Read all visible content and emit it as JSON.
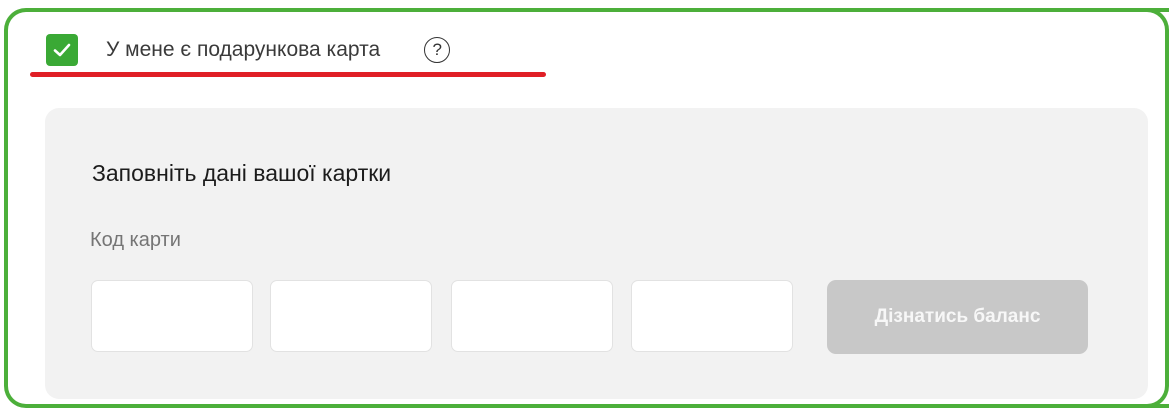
{
  "gift_card": {
    "checkbox_checked": true,
    "checkbox_label": "У мене є подарункова карта",
    "help_icon": "question-circle-icon",
    "check_icon": "checkmark-icon",
    "panel_title": "Заповніть дані вашої картки",
    "code_label": "Код карти",
    "code_fields": [
      "",
      "",
      "",
      ""
    ],
    "balance_button_label": "Дізнатись баланс",
    "balance_button_enabled": false
  },
  "colors": {
    "frame_border": "#4caf3a",
    "checkbox_fill": "#3aa935",
    "underline": "#e01f26",
    "panel_background": "#f2f2f2",
    "button_disabled": "#c8c8c8"
  }
}
